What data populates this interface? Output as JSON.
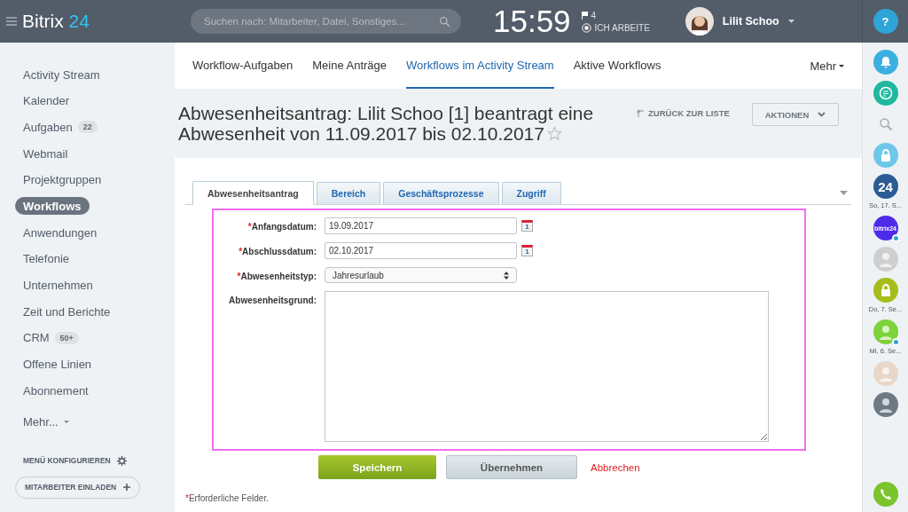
{
  "header": {
    "logo_main": "Bitrix",
    "logo_accent": "24",
    "search": {
      "placeholder": "Suchen nach: Mitarbeiter, Datei, Sonstiges..."
    },
    "clock": "15:59",
    "flag_count": "4",
    "work_status": "ICH ARBEITE",
    "user": "Lilit Schoo",
    "help": "?"
  },
  "sidebar": {
    "items": [
      {
        "label": "Activity Stream",
        "selected": false
      },
      {
        "label": "Kalender",
        "selected": false
      },
      {
        "label": "Aufgaben",
        "badge": "22",
        "selected": false
      },
      {
        "label": "Webmail",
        "selected": false
      },
      {
        "label": "Projektgruppen",
        "selected": false
      },
      {
        "label": "Workflows",
        "selected": true
      },
      {
        "label": "Anwendungen",
        "selected": false
      },
      {
        "label": "Telefonie",
        "selected": false
      },
      {
        "label": "Unternehmen",
        "selected": false
      },
      {
        "label": "Zeit und Berichte",
        "selected": false
      },
      {
        "label": "CRM",
        "badge": "50+",
        "selected": false
      },
      {
        "label": "Offene Linien",
        "selected": false
      },
      {
        "label": "Abonnement",
        "selected": false
      }
    ],
    "more": "Mehr...",
    "configure": "MENÜ KONFIGURIEREN",
    "invite": "MITARBEITER EINLADEN"
  },
  "nav_tabs": [
    {
      "label": "Workflow-Aufgaben",
      "selected": false
    },
    {
      "label": "Meine Anträge",
      "selected": false
    },
    {
      "label": "Workflows im Activity Stream",
      "selected": true
    },
    {
      "label": "Aktive Workflows",
      "selected": false
    }
  ],
  "nav_more": "Mehr",
  "page_title": "Abwesenheitsantrag: Lilit Schoo [1] beantragt eine Abwesenheit von 11.09.2017 bis 02.10.2017",
  "back_link": "ZURÜCK ZUR LISTE",
  "actions_button": "AKTIONEN",
  "form_tabs": [
    {
      "label": "Abwesenheitsantrag",
      "selected": true
    },
    {
      "label": "Bereich",
      "selected": false
    },
    {
      "label": "Geschäftsprozesse",
      "selected": false
    },
    {
      "label": "Zugriff",
      "selected": false
    }
  ],
  "fields": [
    {
      "kind": "date",
      "required_mark": "*",
      "label": "Anfangsdatum:",
      "value": "19.09.2017",
      "calendar_day": "1"
    },
    {
      "kind": "date",
      "required_mark": "*",
      "label": "Abschlussdatum:",
      "value": "02.10.2017",
      "calendar_day": "1"
    },
    {
      "kind": "select",
      "required_mark": "*",
      "label": "Abwesenheitstyp:",
      "value": "Jahresurlaub"
    },
    {
      "kind": "textarea",
      "label": "Abwesenheitsgrund:"
    }
  ],
  "buttons": {
    "save": "Speichern",
    "apply": "Übernehmen",
    "cancel": "Abbrechen"
  },
  "footnote": {
    "mark": "*",
    "text": "Erforderliche Felder."
  },
  "right_rail": [
    {
      "kind": "notifications",
      "color": "#3bb0e0"
    },
    {
      "kind": "chat",
      "color": "#1fb89e"
    },
    {
      "kind": "search"
    },
    {
      "kind": "lock",
      "color": "#6ec7e8"
    },
    {
      "kind": "app",
      "color": "#2b5c95",
      "text": "24"
    },
    {
      "kind": "date",
      "text": "So, 17. S..."
    },
    {
      "kind": "app",
      "color": "#4d2be8",
      "text": "bitrix24",
      "online": true
    },
    {
      "kind": "avatar",
      "color": "#cfcfcf"
    },
    {
      "kind": "lock",
      "color": "#a6bd1c"
    },
    {
      "kind": "date",
      "text": "Do, 7. Se..."
    },
    {
      "kind": "avatar",
      "color": "#7ed23a",
      "online": true
    },
    {
      "kind": "date",
      "text": "Mi, 6. Se..."
    },
    {
      "kind": "avatar",
      "color": "#e8d6c8"
    },
    {
      "kind": "avatar",
      "color": "#6d7a86"
    },
    {
      "kind": "phone",
      "color": "#7bc42c"
    }
  ]
}
